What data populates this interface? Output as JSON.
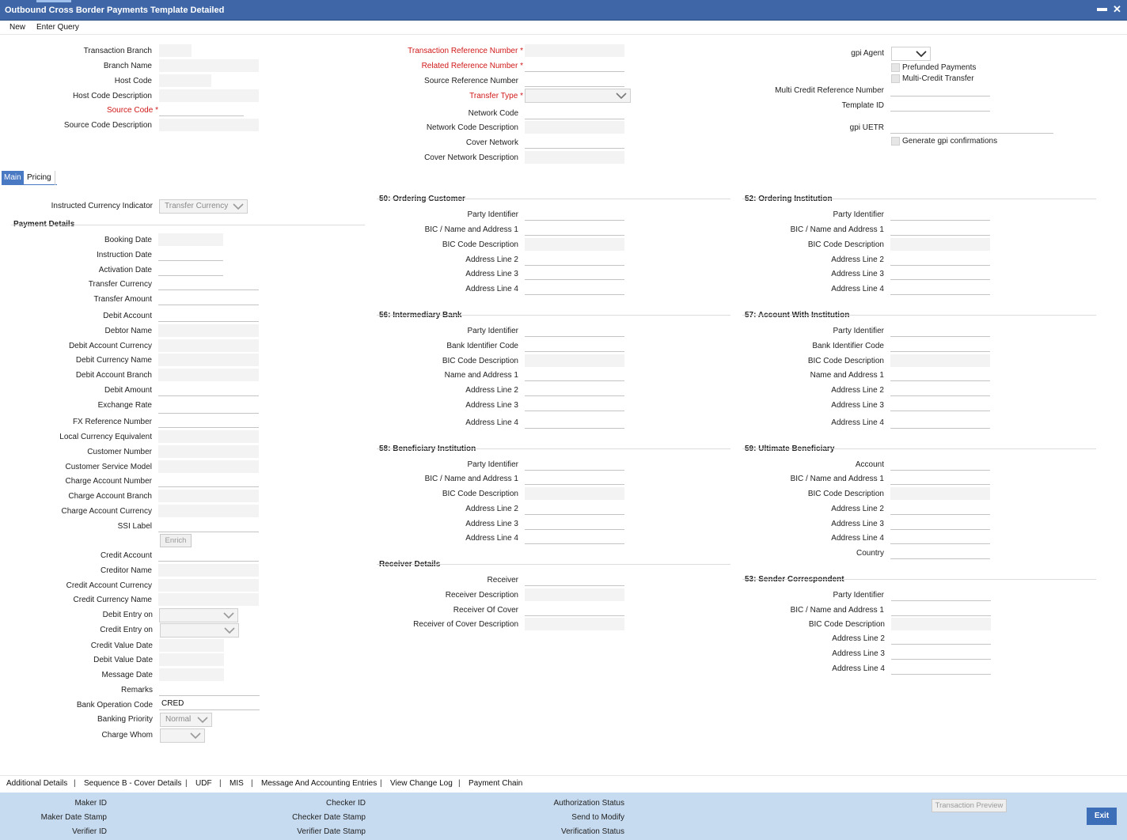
{
  "window": {
    "title": "Outbound Cross Border Payments Template Detailed",
    "minimize_glyph": "▬",
    "close_glyph": "✕"
  },
  "menu": {
    "new": "New",
    "enter_query": "Enter Query"
  },
  "header": {
    "col1": {
      "transaction_branch": "Transaction Branch",
      "branch_name": "Branch Name",
      "host_code": "Host Code",
      "host_code_description": "Host Code Description",
      "source_code": "Source Code",
      "source_code_description": "Source Code Description"
    },
    "col2": {
      "transaction_reference_number": "Transaction Reference Number",
      "related_reference_number": "Related Reference Number",
      "source_reference_number": "Source Reference Number",
      "transfer_type": "Transfer Type",
      "network_code": "Network Code",
      "network_code_description": "Network Code Description",
      "cover_network": "Cover Network",
      "cover_network_description": "Cover Network Description"
    },
    "col3": {
      "gpi_agent": "gpi Agent",
      "prefunded_payments": "Prefunded Payments",
      "multi_credit_transfer": "Multi-Credit Transfer",
      "multi_credit_reference_number": "Multi Credit Reference Number",
      "template_id": "Template ID",
      "gpi_uetr": "gpi UETR",
      "generate_gpi_confirmations": "Generate gpi confirmations"
    },
    "required_mark": "*"
  },
  "tabs": {
    "main": "Main",
    "pricing": "Pricing"
  },
  "main": {
    "instructed_currency_indicator": "Instructed Currency Indicator",
    "instructed_currency_value": "Transfer Currency",
    "payment_details_title": "Payment Details",
    "booking_date": "Booking Date",
    "instruction_date": "Instruction Date",
    "activation_date": "Activation Date",
    "transfer_currency": "Transfer Currency",
    "transfer_amount": "Transfer Amount",
    "debit_account": "Debit Account",
    "debtor_name": "Debtor Name",
    "debit_account_currency": "Debit Account Currency",
    "debit_currency_name": "Debit Currency Name",
    "debit_account_branch": "Debit Account Branch",
    "debit_amount": "Debit Amount",
    "exchange_rate": "Exchange Rate",
    "fx_reference_number": "FX Reference Number",
    "local_currency_equivalent": "Local Currency Equivalent",
    "customer_number": "Customer Number",
    "customer_service_model": "Customer Service Model",
    "charge_account_number": "Charge Account Number",
    "charge_account_branch": "Charge Account Branch",
    "charge_account_currency": "Charge Account Currency",
    "ssi_label": "SSI Label",
    "enrich": "Enrich",
    "credit_account": "Credit Account",
    "creditor_name": "Creditor Name",
    "credit_account_currency": "Credit Account Currency",
    "credit_currency_name": "Credit Currency Name",
    "debit_entry_on": "Debit Entry on",
    "credit_entry_on": "Credit Entry on",
    "credit_value_date": "Credit Value Date",
    "debit_value_date": "Debit Value Date",
    "message_date": "Message Date",
    "remarks": "Remarks",
    "bank_operation_code": "Bank Operation Code",
    "bank_operation_code_value": "CRED",
    "banking_priority": "Banking Priority",
    "banking_priority_value": "Normal",
    "charge_whom": "Charge Whom"
  },
  "ordering_customer": {
    "title": "50: Ordering Customer",
    "party_identifier": "Party Identifier",
    "bic_name_address1": "BIC / Name and Address 1",
    "bic_code_description": "BIC Code Description",
    "address_line_2": "Address Line 2",
    "address_line_3": "Address Line 3",
    "address_line_4": "Address Line 4"
  },
  "ordering_institution": {
    "title": "52: Ordering Institution",
    "party_identifier": "Party Identifier",
    "bic_name_address1": "BIC / Name and Address 1",
    "bic_code_description": "BIC Code Description",
    "address_line_2": "Address Line 2",
    "address_line_3": "Address Line 3",
    "address_line_4": "Address Line 4"
  },
  "intermediary_bank": {
    "title": "56: Intermediary Bank",
    "party_identifier": "Party Identifier",
    "bank_identifier_code": "Bank Identifier Code",
    "bic_code_description": "BIC Code Description",
    "name_and_address_1": "Name and Address 1",
    "address_line_2": "Address Line 2",
    "address_line_3": "Address Line 3",
    "address_line_4": "Address Line 4"
  },
  "account_with_institution": {
    "title": "57: Account With Institution",
    "party_identifier": "Party Identifier",
    "bank_identifier_code": "Bank Identifier Code",
    "bic_code_description": "BIC Code Description",
    "name_and_address_1": "Name and Address 1",
    "address_line_2": "Address Line 2",
    "address_line_3": "Address Line 3",
    "address_line_4": "Address Line 4"
  },
  "beneficiary_institution": {
    "title": "58: Beneficiary Institution",
    "party_identifier": "Party Identifier",
    "bic_name_address1": "BIC / Name and Address 1",
    "bic_code_description": "BIC Code Description",
    "address_line_2": "Address Line 2",
    "address_line_3": "Address Line 3",
    "address_line_4": "Address Line 4"
  },
  "ultimate_beneficiary": {
    "title": "59: Ultimate Beneficiary",
    "account": "Account",
    "bic_name_address1": "BIC / Name and Address 1",
    "bic_code_description": "BIC Code Description",
    "address_line_2": "Address Line 2",
    "address_line_3": "Address Line 3",
    "address_line_4": "Address Line 4",
    "country": "Country"
  },
  "receiver_details": {
    "title": "Receiver Details",
    "receiver": "Receiver",
    "receiver_description": "Receiver Description",
    "receiver_of_cover": "Receiver Of Cover",
    "receiver_of_cover_description": "Receiver of Cover Description"
  },
  "sender_correspondent": {
    "title": "53: Sender Correspondent",
    "party_identifier": "Party Identifier",
    "bic_name_address1": "BIC / Name and Address 1",
    "bic_code_description": "BIC Code Description",
    "address_line_2": "Address Line 2",
    "address_line_3": "Address Line 3",
    "address_line_4": "Address Line 4"
  },
  "bottom_links": {
    "separator": "|",
    "additional_details": "Additional Details",
    "sequence_b": "Sequence B - Cover Details",
    "udf": "UDF",
    "mis": "MIS",
    "message_accounting": "Message And Accounting Entries",
    "view_change_log": "View Change Log",
    "payment_chain": "Payment Chain"
  },
  "footer": {
    "maker_id": "Maker ID",
    "maker_date_stamp": "Maker Date Stamp",
    "verifier_id": "Verifier ID",
    "checker_id": "Checker ID",
    "checker_date_stamp": "Checker Date Stamp",
    "verifier_date_stamp": "Verifier Date Stamp",
    "authorization_status": "Authorization Status",
    "send_to_modify": "Send to Modify",
    "verification_status": "Verification Status",
    "transaction_preview": "Transaction Preview",
    "exit": "Exit"
  },
  "colors": {
    "title_bar": "#3f67a8",
    "required_label": "#d01818",
    "footer_bg": "#c7dbf0",
    "exit_button": "#3d6eb8",
    "active_tab": "#4a79c4"
  }
}
